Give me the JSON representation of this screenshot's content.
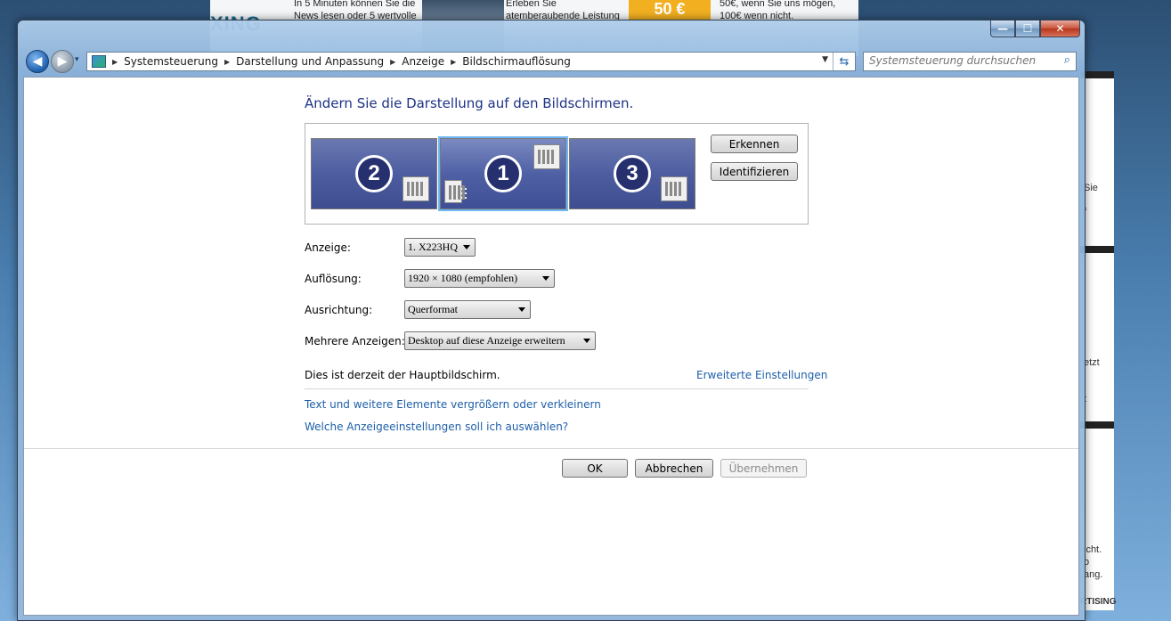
{
  "background": {
    "ad_text_1": "In 5 Minuten können Sie die News lesen oder 5 wertvolle",
    "ad_text_2": "Erleben Sie atemberaubende Leistung",
    "ad_promo": "50 €",
    "ad_text_3": "50€, wenn Sie uns mögen, 100€ wenn nicht.",
    "right_texts": [
      "Sie",
      "f",
      "etzt",
      "t",
      "icht.",
      "o",
      "ang.",
      "RTISING"
    ]
  },
  "window": {
    "caption": {
      "minimize": "—",
      "maximize": "☐",
      "close": "✕"
    },
    "nav": {
      "back": "◀",
      "forward": "▶",
      "dropdown": "▾"
    },
    "breadcrumb": [
      "Systemsteuerung",
      "Darstellung und Anpassung",
      "Anzeige",
      "Bildschirmauflösung"
    ],
    "search_placeholder": "Systemsteuerung durchsuchen"
  },
  "main": {
    "heading": "Ändern Sie die Darstellung auf den Bildschirmen.",
    "monitors": [
      {
        "number": "2",
        "selected": false
      },
      {
        "number": "1",
        "selected": true
      },
      {
        "number": "3",
        "selected": false
      }
    ],
    "detect_button": "Erkennen",
    "identify_button": "Identifizieren",
    "display_label": "Anzeige:",
    "display_value": "1. X223HQ",
    "resolution_label": "Auflösung:",
    "resolution_value": "1920 × 1080 (empfohlen)",
    "orientation_label": "Ausrichtung:",
    "orientation_value": "Querformat",
    "multiple_label": "Mehrere Anzeigen:",
    "multiple_value": "Desktop auf diese Anzeige erweitern",
    "primary_info": "Dies ist derzeit der Hauptbildschirm.",
    "advanced_link": "Erweiterte Einstellungen",
    "text_size_link": "Text und weitere Elemente vergrößern oder verkleinern",
    "help_link": "Welche Anzeigeeinstellungen soll ich auswählen?",
    "ok_button": "OK",
    "cancel_button": "Abbrechen",
    "apply_button": "Übernehmen"
  }
}
